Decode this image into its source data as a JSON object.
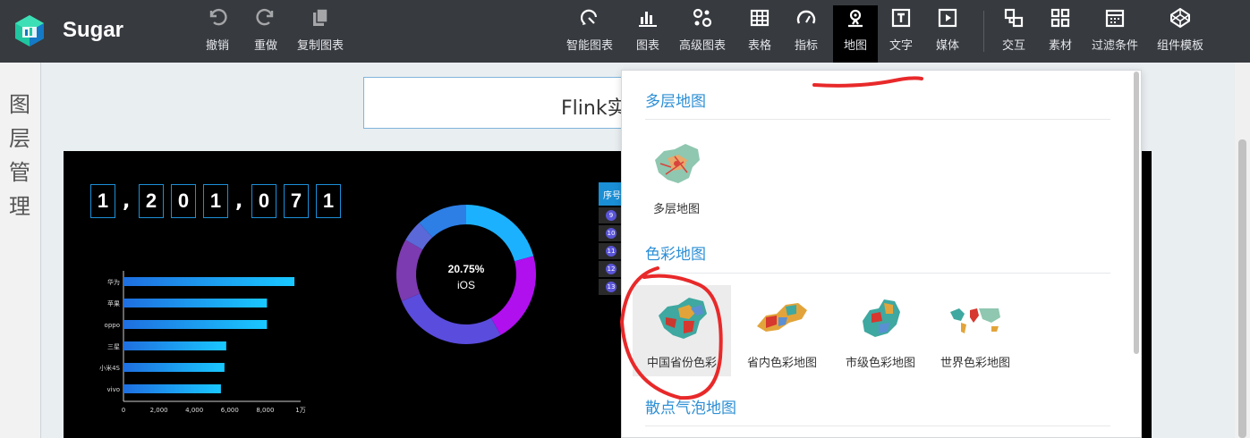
{
  "app": {
    "name": "Sugar"
  },
  "edit_tools": [
    {
      "label": "撤销",
      "icon": "undo-icon"
    },
    {
      "label": "重做",
      "icon": "redo-icon"
    },
    {
      "label": "复制图表",
      "icon": "copy-icon"
    }
  ],
  "component_tools": [
    {
      "label": "智能图表",
      "icon": "smart-chart-icon"
    },
    {
      "label": "图表",
      "icon": "bar-chart-icon"
    },
    {
      "label": "高级图表",
      "icon": "advanced-chart-icon"
    },
    {
      "label": "表格",
      "icon": "table-icon"
    },
    {
      "label": "指标",
      "icon": "gauge-icon"
    },
    {
      "label": "地图",
      "icon": "map-pin-icon",
      "active": true
    },
    {
      "label": "文字",
      "icon": "text-icon"
    },
    {
      "label": "媒体",
      "icon": "media-play-icon"
    },
    {
      "label": "交互",
      "icon": "interaction-icon"
    },
    {
      "label": "素材",
      "icon": "material-grid-icon"
    },
    {
      "label": "过滤条件",
      "icon": "filter-calendar-icon"
    },
    {
      "label": "组件模板",
      "icon": "template-codepen-icon"
    }
  ],
  "left_panel": {
    "title": "图层管理"
  },
  "canvas": {
    "title_text": "Flink实",
    "counter_digits": [
      "1",
      ",",
      "2",
      "0",
      "1",
      ",",
      "0",
      "7",
      "1"
    ],
    "donut": {
      "percent_label": "20.75%",
      "name": "iOS"
    },
    "table_header": "序号",
    "table_rows": [
      "9",
      "10",
      "11",
      "12",
      "13"
    ]
  },
  "chart_data": [
    {
      "type": "bar",
      "orientation": "horizontal",
      "categories": [
        "华为",
        "苹果",
        "oppo",
        "三星",
        "小米4S",
        "vivo"
      ],
      "values": [
        9650,
        8100,
        8100,
        5800,
        5700,
        5500
      ],
      "xlim": [
        0,
        10000
      ],
      "x_ticks": [
        "0",
        "2,000",
        "4,000",
        "6,000",
        "8,000",
        "1万"
      ],
      "colors": [
        "#1f6fe0",
        "#19c8ff"
      ]
    },
    {
      "type": "pie",
      "variant": "donut",
      "slices": [
        {
          "name": "iOS",
          "value": 20.75,
          "color": "#1cb1ff"
        },
        {
          "name": "",
          "value": 21.0,
          "color": "#b010ee"
        },
        {
          "name": "",
          "value": 27.0,
          "color": "#5a4cdc"
        },
        {
          "name": "",
          "value": 14.5,
          "color": "#7c3bb0"
        },
        {
          "name": "",
          "value": 5.0,
          "color": "#5b68d8"
        },
        {
          "name": "",
          "value": 11.75,
          "color": "#2d7fe6"
        }
      ],
      "center_text": "20.75%",
      "center_sub": "iOS"
    }
  ],
  "dropdown": {
    "sections": [
      {
        "title": "多层地图",
        "items": [
          {
            "label": "多层地图",
            "icon": "multi-layer-map-icon"
          }
        ]
      },
      {
        "title": "色彩地图",
        "items": [
          {
            "label": "中国省份色彩",
            "icon": "china-province-map-icon",
            "selected": true
          },
          {
            "label": "省内色彩地图",
            "icon": "province-inner-map-icon"
          },
          {
            "label": "市级色彩地图",
            "icon": "city-level-map-icon"
          },
          {
            "label": "世界色彩地图",
            "icon": "world-map-icon"
          }
        ]
      },
      {
        "title": "散点气泡地图",
        "items": []
      }
    ]
  },
  "annotations": {
    "color": "#e8292a"
  }
}
